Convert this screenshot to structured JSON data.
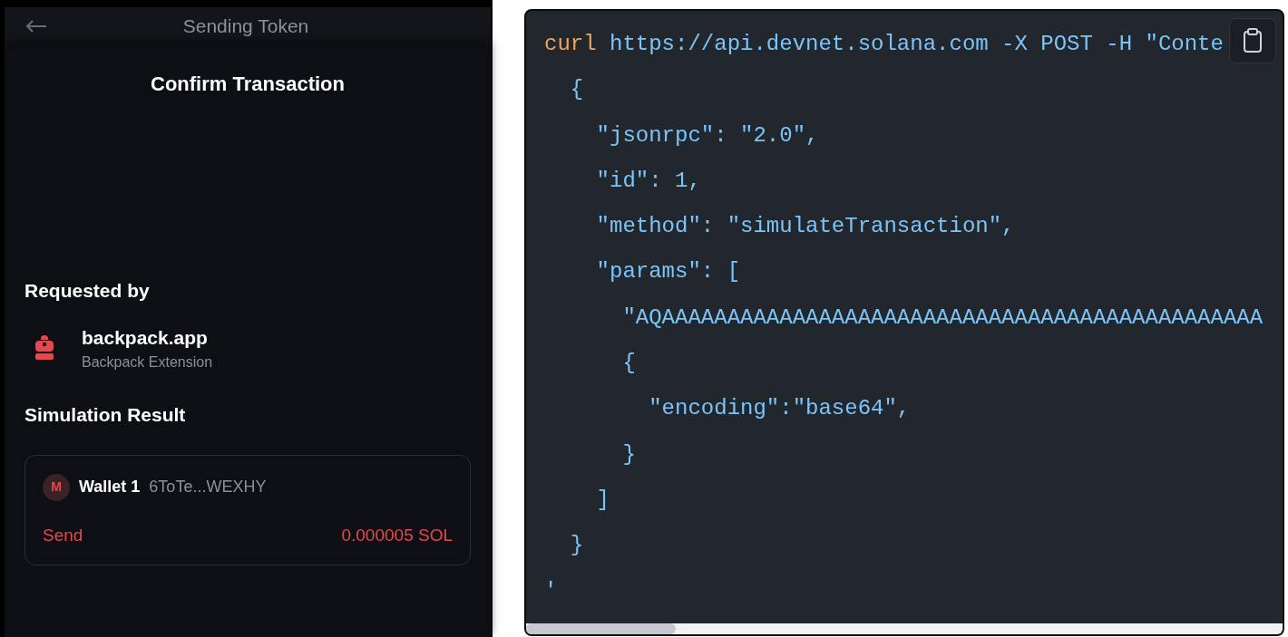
{
  "wallet_popup": {
    "header": {
      "title": "Sending Token"
    },
    "sheet": {
      "title": "Confirm Transaction",
      "requested_by": {
        "heading": "Requested by",
        "site": "backpack.app",
        "source": "Backpack Extension"
      },
      "simulation": {
        "heading": "Simulation Result",
        "avatar": "M",
        "wallet_name": "Wallet 1",
        "address": "6ToTe...WEXHY",
        "action": "Send",
        "amount": "0.000005 SOL"
      }
    }
  },
  "code_block": {
    "lines": [
      [
        {
          "kind": "command",
          "text": "curl"
        },
        {
          "kind": "plain",
          "text": " https://api.devnet.solana.com -X POST -H \"Conte"
        }
      ],
      [
        {
          "kind": "plain",
          "text": "  {"
        }
      ],
      [
        {
          "kind": "plain",
          "text": "    \"jsonrpc\": \"2.0\","
        }
      ],
      [
        {
          "kind": "plain",
          "text": "    \"id\": 1,"
        }
      ],
      [
        {
          "kind": "plain",
          "text": "    \"method\": \"simulateTransaction\","
        }
      ],
      [
        {
          "kind": "plain",
          "text": "    \"params\": ["
        }
      ],
      [
        {
          "kind": "plain",
          "text": "      \"AQAAAAAAAAAAAAAAAAAAAAAAAAAAAAAAAAAAAAAAAAAAAAAA"
        }
      ],
      [
        {
          "kind": "plain",
          "text": "      {"
        }
      ],
      [
        {
          "kind": "plain",
          "text": "        \"encoding\":\"base64\","
        }
      ],
      [
        {
          "kind": "plain",
          "text": "      }"
        }
      ],
      [
        {
          "kind": "plain",
          "text": "    ]"
        }
      ],
      [
        {
          "kind": "plain",
          "text": "  }"
        }
      ],
      [
        {
          "kind": "plain",
          "text": "'"
        }
      ]
    ]
  }
}
